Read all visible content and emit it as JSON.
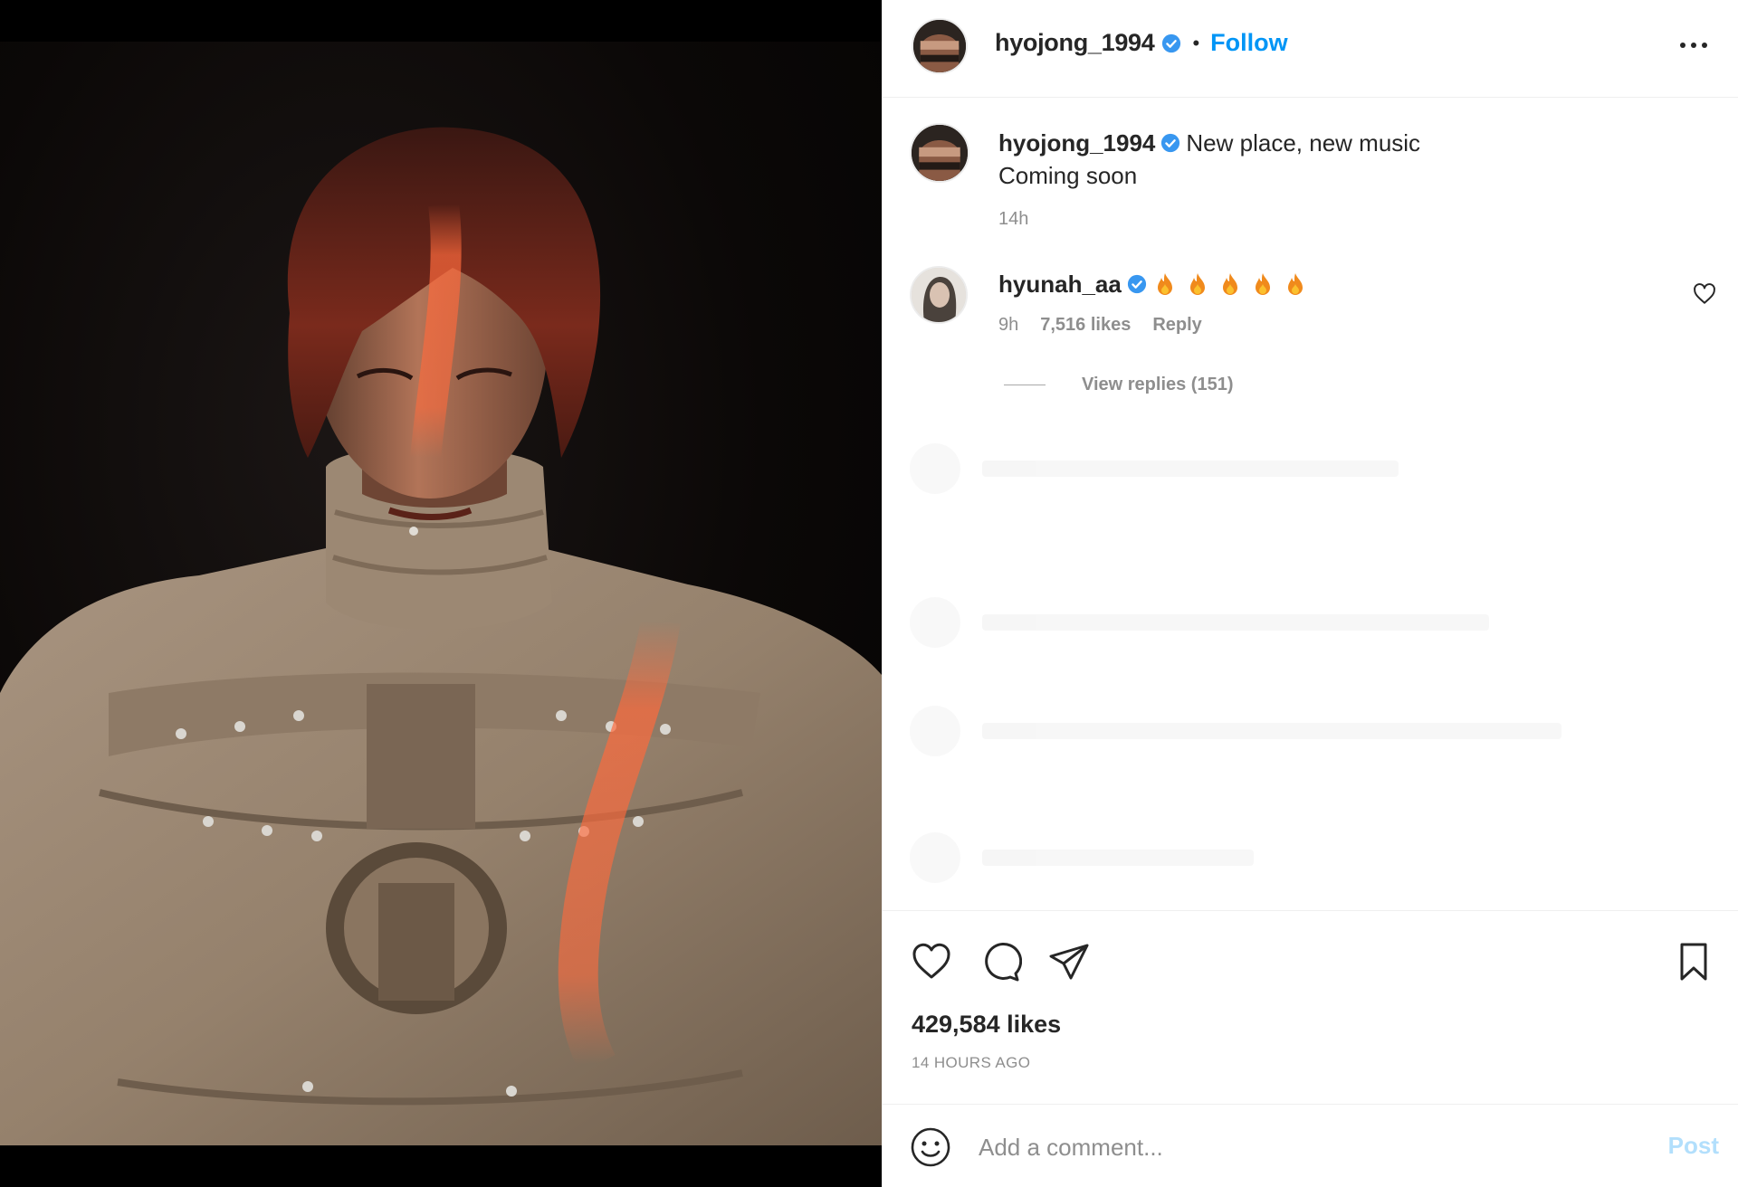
{
  "post": {
    "username": "hyojong_1994",
    "follow_label": "Follow",
    "separator": "•",
    "photo_alt": "Portrait of a man with red-tinted hair in a beige turtleneck with cut-outs and metal studs"
  },
  "caption": {
    "username": "hyojong_1994",
    "line1": "New place, new music",
    "line2": "Coming soon",
    "time": "14h"
  },
  "comment": {
    "username": "hyunah_aa",
    "emoji_count": 5,
    "time": "9h",
    "likes": "7,516 likes",
    "reply_label": "Reply",
    "view_replies": "View replies (151)"
  },
  "actions": {
    "likes": "429,584 likes",
    "timestamp": "14 HOURS AGO"
  },
  "add_comment": {
    "placeholder": "Add a comment...",
    "post_label": "Post"
  },
  "colors": {
    "accent": "#0095f6",
    "verified": "#3897f0",
    "muted": "#8e8e8e",
    "post_disabled": "#b2dffc"
  },
  "icons": {
    "more": "more-options-icon",
    "verified": "verified-badge-icon",
    "like": "heart-icon",
    "comment": "comment-bubble-icon",
    "share": "paper-plane-icon",
    "save": "bookmark-icon",
    "emoji": "smiley-face-icon",
    "fire": "fire-emoji-icon"
  }
}
